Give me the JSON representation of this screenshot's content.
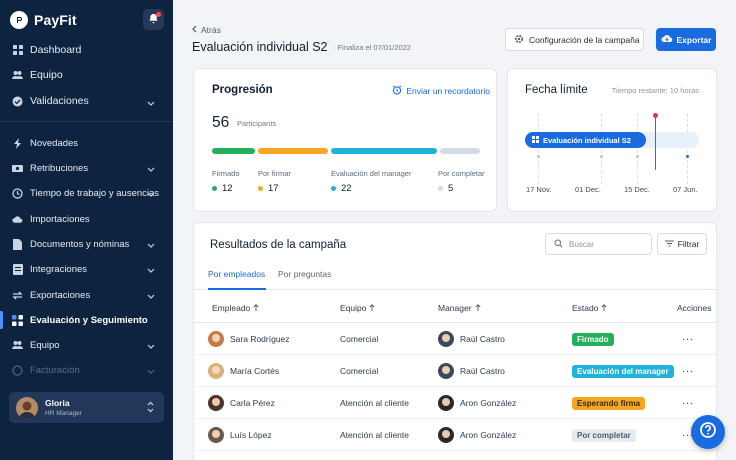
{
  "app": {
    "name": "PayFit"
  },
  "sidebar": {
    "top_items": [
      {
        "label": "Dashboard",
        "icon": "dashboard-icon"
      },
      {
        "label": "Equipo",
        "icon": "team-icon"
      },
      {
        "label": "Validaciones",
        "icon": "check-circle-icon"
      }
    ],
    "items": [
      {
        "label": "Novedades",
        "icon": "bolt-icon"
      },
      {
        "label": "Retribuciones",
        "icon": "money-icon"
      },
      {
        "label": "Tiempo de trabajo y ausencias",
        "icon": "clock-icon"
      },
      {
        "label": "Importaciones",
        "icon": "cloud-upload-icon"
      },
      {
        "label": "Documentos y nóminas",
        "icon": "document-icon"
      },
      {
        "label": "Integraciones",
        "icon": "integrations-icon"
      },
      {
        "label": "Exportaciones",
        "icon": "exchange-icon"
      },
      {
        "label": "Evaluación y Seguimiento",
        "icon": "evaluation-icon"
      },
      {
        "label": "Equipo",
        "icon": "team-icon"
      },
      {
        "label": "Facturación",
        "icon": "billing-icon"
      }
    ],
    "user": {
      "name": "Gloria",
      "role": "HR Manager"
    }
  },
  "header": {
    "back_label": "Atrás",
    "title": "Evaluación individual S2",
    "subtitle": "· Finaliza el 07/01/2022",
    "config_button": "Configuración de la campaña",
    "export_button": "Exportar"
  },
  "progress": {
    "title": "Progresión",
    "reminder_label": "Enviar un recordatorio",
    "count": "56",
    "count_label": "Participants",
    "stats": [
      {
        "label": "Firmado",
        "value": "12",
        "color": "#22b05a"
      },
      {
        "label": "Por firmar",
        "value": "17",
        "color": "#f5a623"
      },
      {
        "label": "Evaluación del manager",
        "value": "22",
        "color": "#1fb3d9"
      },
      {
        "label": "Por completar",
        "value": "5",
        "color": "#d5dbe3"
      }
    ]
  },
  "deadline": {
    "title": "Fecha límite",
    "remaining": "Tiempo restante: 10 horas",
    "campaign_label": "Evaluación individual S2",
    "ticks": [
      "17 Nov.",
      "01 Dec.",
      "15 Dec.",
      "07 Jun."
    ]
  },
  "results": {
    "title": "Resultados de la campaña",
    "search_placeholder": "Buscar",
    "filter_label": "Filtrar",
    "tabs": [
      "Por empleados",
      "Por preguntas"
    ],
    "columns": [
      "Empleado",
      "Equipo",
      "Manager",
      "Estado",
      "Acciones"
    ],
    "rows": [
      {
        "employee": "Sara Rodríguez",
        "team": "Comercial",
        "manager": "Raúl Castro",
        "status": "Firmado",
        "status_bg": "#22b05a",
        "status_fg": "#ffffff"
      },
      {
        "employee": "María Cortés",
        "team": "Comercial",
        "manager": "Raúl Castro",
        "status": "Evaluación del manager",
        "status_bg": "#1fb3d9",
        "status_fg": "#ffffff"
      },
      {
        "employee": "Carla Pérez",
        "team": "Atención al cliente",
        "manager": "Aron González",
        "status": "Esperando firma",
        "status_bg": "#f5a623",
        "status_fg": "#3a2a05"
      },
      {
        "employee": "Luís López",
        "team": "Atención al cliente",
        "manager": "Aron González",
        "status": "Por completar",
        "status_bg": "#e6eaef",
        "status_fg": "#4b5b70"
      }
    ],
    "actions_label": "···"
  },
  "colors": {
    "sidebar_bg": "#0d2340",
    "accent": "#1a6be0"
  }
}
